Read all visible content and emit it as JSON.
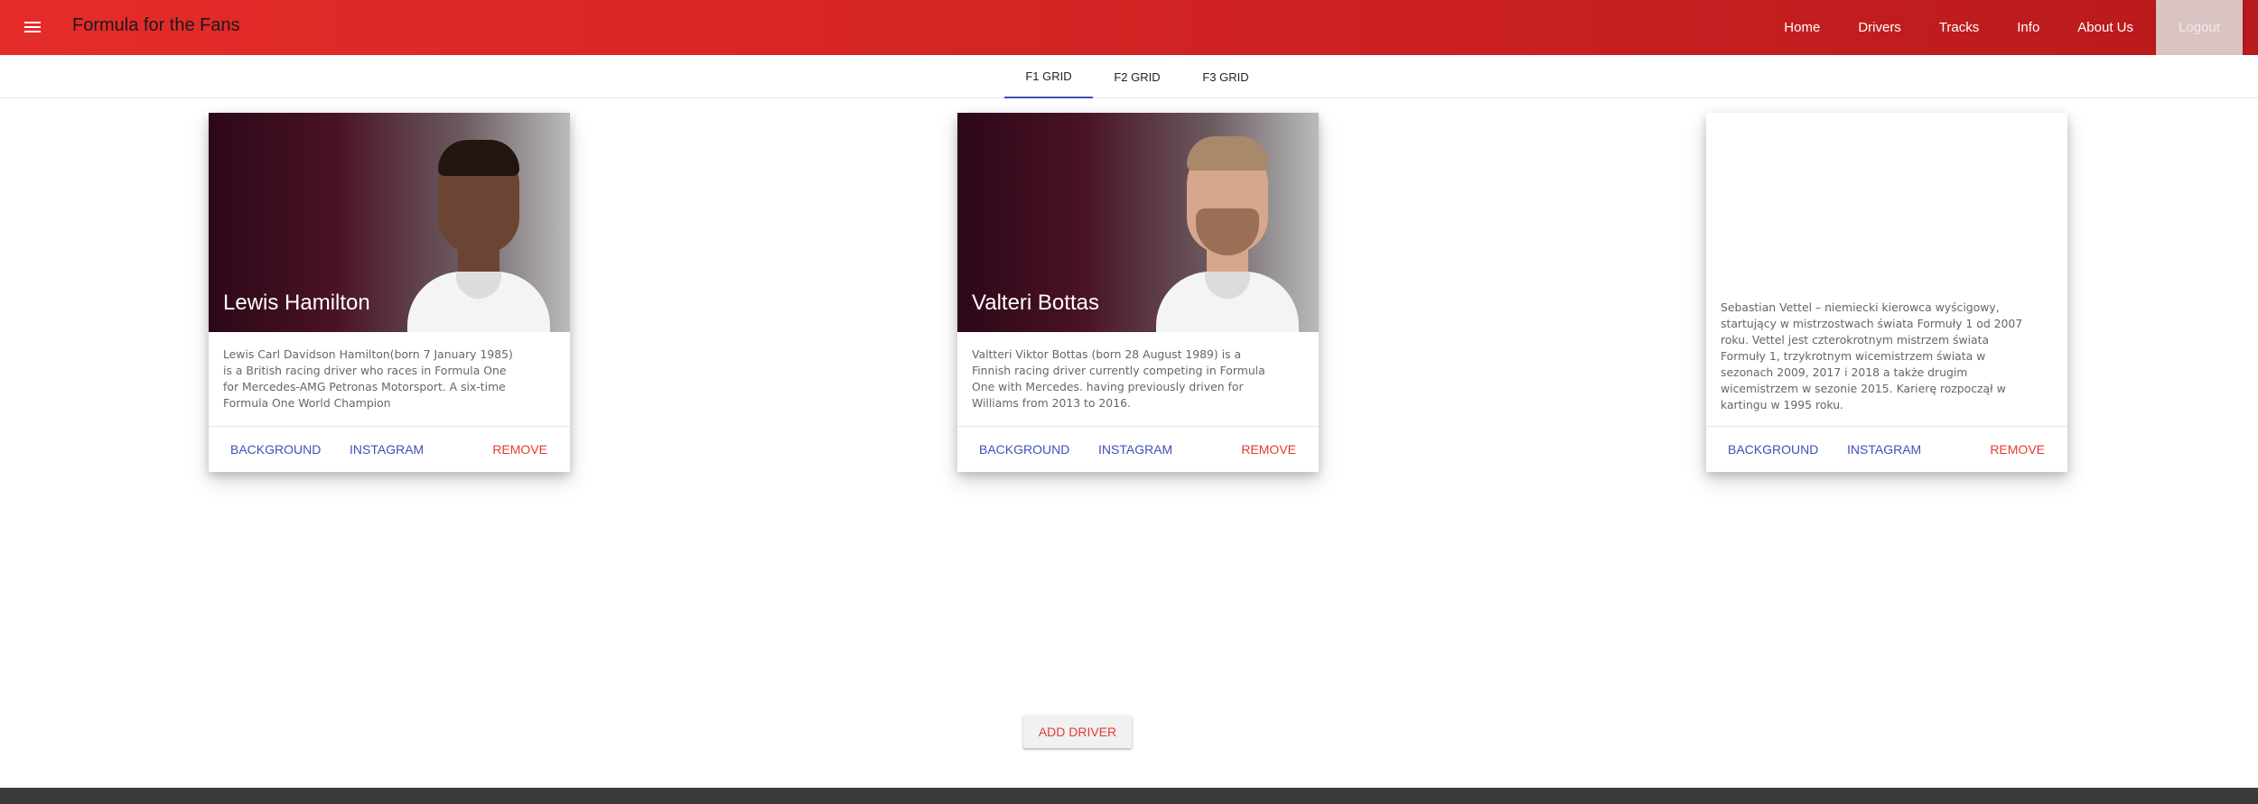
{
  "header": {
    "title": "Formula for the Fans",
    "nav": [
      "Home",
      "Drivers",
      "Tracks",
      "Info",
      "About Us"
    ],
    "logout": "Logout"
  },
  "tabs": [
    "F1 GRID",
    "F2 GRID",
    "F3 GRID"
  ],
  "active_tab": "F1 GRID",
  "cards": [
    {
      "name": "Lewis Hamilton",
      "description": "Lewis Carl Davidson Hamilton(born 7 January 1985) is a British racing driver who races in Formula One for Mercedes-AMG Petronas Motorsport. A six-time Formula One World Champion",
      "actions": {
        "background": "BACKGROUND",
        "instagram": "INSTAGRAM",
        "remove": "REMOVE"
      }
    },
    {
      "name": "Valteri Bottas",
      "description": "Valtteri Viktor Bottas (born 28 August 1989) is a Finnish racing driver currently competing in Formula One with Mercedes. having previously driven for Williams from 2013 to 2016.",
      "actions": {
        "background": "BACKGROUND",
        "instagram": "INSTAGRAM",
        "remove": "REMOVE"
      }
    },
    {
      "name": "",
      "description": "Sebastian Vettel – niemiecki kierowca wyścigowy, startujący w mistrzostwach świata Formuły 1 od 2007 roku. Vettel jest czterokrotnym mistrzem świata Formuły 1, trzykrotnym wicemistrzem świata w sezonach 2009, 2017 i 2018 a także drugim wicemistrzem w sezonie 2015. Karierę rozpoczął w kartingu w 1995 roku.",
      "actions": {
        "background": "BACKGROUND",
        "instagram": "INSTAGRAM",
        "remove": "REMOVE"
      }
    }
  ],
  "add_driver": "ADD DRIVER",
  "colors": {
    "primary": "#e52c2a",
    "accent": "#3f51b5",
    "danger": "#e53935"
  }
}
